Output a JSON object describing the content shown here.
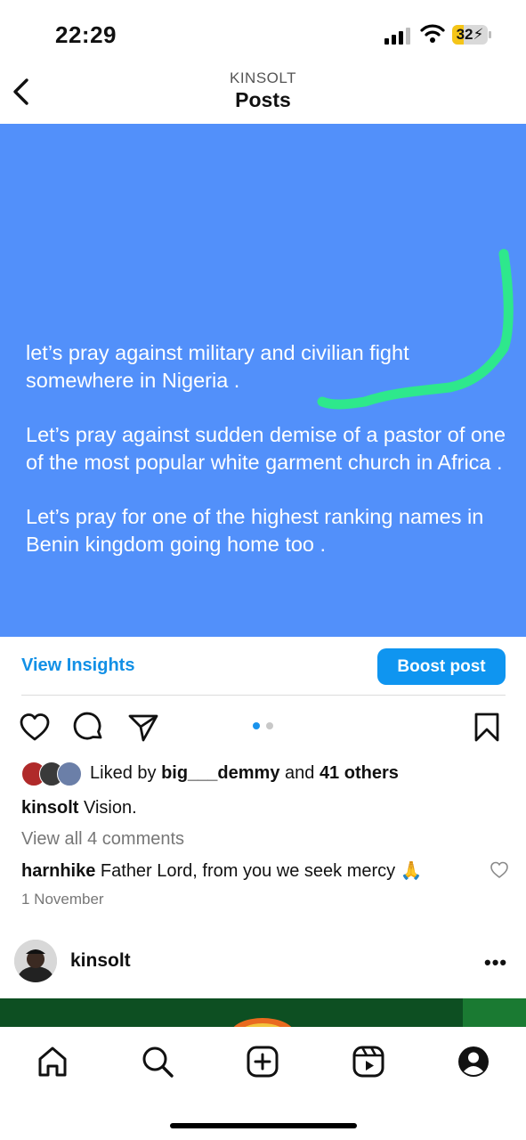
{
  "status_bar": {
    "time": "22:29",
    "battery_level": "32",
    "battery_color": "#f5c518",
    "icons": [
      "cellular-signal-icon",
      "wifi-icon",
      "battery-charging-icon"
    ]
  },
  "header": {
    "username": "KINSOLT",
    "title": "Posts",
    "back_icon": "chevron-left-icon"
  },
  "post": {
    "background_color": "#5290fa",
    "text_paragraphs": [
      "let’s pray against military and civilian fight somewhere in Nigeria .",
      "Let’s pray against sudden demise of a pastor of one of the most popular white garment church in Africa .",
      "Let’s pray for one of the highest ranking names in Benin kingdom going home too ."
    ],
    "annotation_color": "#2ee88c"
  },
  "insights": {
    "view_insights_label": "View Insights",
    "boost_label": "Boost post",
    "accent_color": "#0f95f0"
  },
  "actions": {
    "icons": [
      "heart-icon",
      "comment-icon",
      "share-icon",
      "bookmark-icon"
    ],
    "carousel_dots": 2,
    "active_dot": 0
  },
  "likes": {
    "prefix": "Liked by ",
    "user": "big___demmy",
    "middle": " and ",
    "count_text": "41 others"
  },
  "caption": {
    "user": "kinsolt",
    "text": " Vision."
  },
  "comments": {
    "view_all": "View all 4 comments",
    "top_comment_user": "harnhike",
    "top_comment_text": " Father Lord, from you we seek mercy 🙏"
  },
  "date": "1 November",
  "next_post": {
    "username": "kinsolt",
    "more_label": "•••"
  },
  "bottom_nav": {
    "items": [
      "home-icon",
      "search-icon",
      "create-icon",
      "reels-icon",
      "profile-icon"
    ]
  }
}
